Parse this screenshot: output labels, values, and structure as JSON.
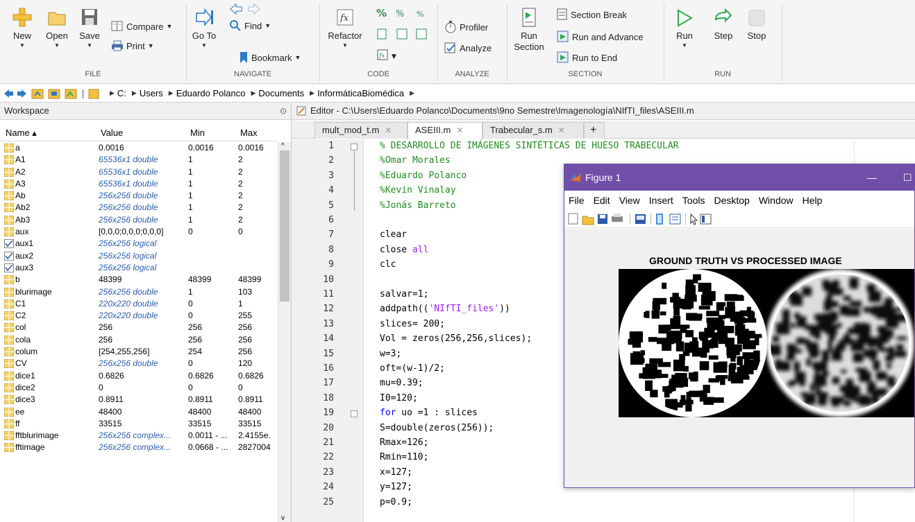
{
  "toolstrip": {
    "file": {
      "new": "New",
      "open": "Open",
      "save": "Save",
      "compare": "Compare",
      "print": "Print",
      "group": "FILE"
    },
    "navigate": {
      "goto": "Go To",
      "find": "Find",
      "bookmark": "Bookmark",
      "group": "NAVIGATE"
    },
    "code": {
      "refactor": "Refactor",
      "group": "CODE"
    },
    "analyze": {
      "profiler": "Profiler",
      "analyze": "Analyze",
      "group": "ANALYZE"
    },
    "section": {
      "run_section_1": "Run",
      "run_section_2": "Section",
      "section_break": "Section Break",
      "run_advance": "Run and Advance",
      "run_to_end": "Run to End",
      "group": "SECTION"
    },
    "run": {
      "run": "Run",
      "step": "Step",
      "stop": "Stop",
      "group": "RUN"
    }
  },
  "address": {
    "crumbs": [
      "C:",
      "Users",
      "Eduardo Polanco",
      "Documents",
      "InformáticaBiomédica"
    ]
  },
  "workspace": {
    "title": "Workspace",
    "columns": {
      "name": "Name ▴",
      "value": "Value",
      "min": "Min",
      "max": "Max"
    },
    "rows": [
      {
        "name": "a",
        "value": "0.0016",
        "min": "0.0016",
        "max": "0.0016",
        "type": "num"
      },
      {
        "name": "A1",
        "value": "65536x1 double",
        "min": "1",
        "max": "2",
        "type": "num",
        "italic": true
      },
      {
        "name": "A2",
        "value": "65536x1 double",
        "min": "1",
        "max": "2",
        "type": "num",
        "italic": true
      },
      {
        "name": "A3",
        "value": "65536x1 double",
        "min": "1",
        "max": "2",
        "type": "num",
        "italic": true
      },
      {
        "name": "Ab",
        "value": "256x256 double",
        "min": "1",
        "max": "2",
        "type": "num",
        "italic": true
      },
      {
        "name": "Ab2",
        "value": "256x256 double",
        "min": "1",
        "max": "2",
        "type": "num",
        "italic": true
      },
      {
        "name": "Ab3",
        "value": "256x256 double",
        "min": "1",
        "max": "2",
        "type": "num",
        "italic": true
      },
      {
        "name": "aux",
        "value": "[0,0,0;0,0,0;0,0,0]",
        "min": "0",
        "max": "0",
        "type": "num"
      },
      {
        "name": "aux1",
        "value": "256x256 logical",
        "min": "",
        "max": "",
        "type": "logical",
        "italic": true
      },
      {
        "name": "aux2",
        "value": "256x256 logical",
        "min": "",
        "max": "",
        "type": "logical",
        "italic": true
      },
      {
        "name": "aux3",
        "value": "256x256 logical",
        "min": "",
        "max": "",
        "type": "logical",
        "italic": true
      },
      {
        "name": "b",
        "value": "48399",
        "min": "48399",
        "max": "48399",
        "type": "num"
      },
      {
        "name": "blurimage",
        "value": "256x256 double",
        "min": "1",
        "max": "103",
        "type": "num",
        "italic": true
      },
      {
        "name": "C1",
        "value": "220x220 double",
        "min": "0",
        "max": "1",
        "type": "num",
        "italic": true
      },
      {
        "name": "C2",
        "value": "220x220 double",
        "min": "0",
        "max": "255",
        "type": "num",
        "italic": true
      },
      {
        "name": "col",
        "value": "256",
        "min": "256",
        "max": "256",
        "type": "num"
      },
      {
        "name": "cola",
        "value": "256",
        "min": "256",
        "max": "256",
        "type": "num"
      },
      {
        "name": "colum",
        "value": "[254,255,256]",
        "min": "254",
        "max": "256",
        "type": "num"
      },
      {
        "name": "CV",
        "value": "256x256 double",
        "min": "0",
        "max": "120",
        "type": "num",
        "italic": true
      },
      {
        "name": "dice1",
        "value": "0.6826",
        "min": "0.6826",
        "max": "0.6826",
        "type": "num"
      },
      {
        "name": "dice2",
        "value": "0",
        "min": "0",
        "max": "0",
        "type": "num"
      },
      {
        "name": "dice3",
        "value": "0.8911",
        "min": "0.8911",
        "max": "0.8911",
        "type": "num"
      },
      {
        "name": "ee",
        "value": "48400",
        "min": "48400",
        "max": "48400",
        "type": "num"
      },
      {
        "name": "ff",
        "value": "33515",
        "min": "33515",
        "max": "33515",
        "type": "num"
      },
      {
        "name": "fftblurimage",
        "value": "256x256 complex...",
        "min": "0.0011 - ...",
        "max": "2.4155e.",
        "type": "num",
        "italic": true
      },
      {
        "name": "fftimage",
        "value": "256x256 complex...",
        "min": "0.0668 - ...",
        "max": "2827004",
        "type": "num",
        "italic": true
      }
    ]
  },
  "editor": {
    "title": "Editor - C:\\Users\\Eduardo Polanco\\Documents\\9no Semestre\\Imagenología\\NIfTI_files\\ASEIII.m",
    "tabs": [
      "mult_mod_t.m",
      "ASEIII.m",
      "Trabecular_s.m"
    ],
    "add_tab": "+",
    "lines": [
      {
        "n": "1",
        "t": "% DESARROLLO DE IMÁGENES SINTÉTICAS DE HUESO TRABECULAR",
        "c": "cm"
      },
      {
        "n": "2",
        "t": "%Omar Morales",
        "c": "cm"
      },
      {
        "n": "3",
        "t": "%Eduardo Polanco",
        "c": "cm"
      },
      {
        "n": "4",
        "t": "%Kevin Vinalay",
        "c": "cm"
      },
      {
        "n": "5",
        "t": "%Jonás Barreto",
        "c": "cm"
      },
      {
        "n": "6",
        "t": "",
        "c": ""
      },
      {
        "n": "7",
        "t": "clear",
        "c": ""
      },
      {
        "n": "8",
        "t": "close ",
        "c": "",
        "extra": "all",
        "extra_c": "str"
      },
      {
        "n": "9",
        "t": "clc",
        "c": ""
      },
      {
        "n": "10",
        "t": "",
        "c": ""
      },
      {
        "n": "11",
        "t": "salvar=1;",
        "c": ""
      },
      {
        "n": "12",
        "t": "addpath((",
        "c": "",
        "extra": "'NIfTI_files'",
        "extra_c": "str",
        "after": "))"
      },
      {
        "n": "13",
        "t": "slices= 200;",
        "c": ""
      },
      {
        "n": "14",
        "t": "Vol = zeros(256,256,slices);",
        "c": ""
      },
      {
        "n": "15",
        "t": "w=3;",
        "c": ""
      },
      {
        "n": "16",
        "t": "oft=(w-1)/2;",
        "c": ""
      },
      {
        "n": "17",
        "t": "mu=0.39;",
        "c": ""
      },
      {
        "n": "18",
        "t": "I0=120;",
        "c": ""
      },
      {
        "n": "19",
        "t": "for",
        "c": "kw",
        "extra": " uo =1 : slices",
        "extra_c": ""
      },
      {
        "n": "20",
        "t": "S=double(zeros(256));",
        "c": ""
      },
      {
        "n": "21",
        "t": "Rmax=126;",
        "c": ""
      },
      {
        "n": "22",
        "t": "Rmin=110;",
        "c": ""
      },
      {
        "n": "23",
        "t": "x=127;",
        "c": ""
      },
      {
        "n": "24",
        "t": "y=127;",
        "c": ""
      },
      {
        "n": "25",
        "t": "p=0.9;",
        "c": ""
      }
    ]
  },
  "figure": {
    "title": "Figure 1",
    "menu": [
      "File",
      "Edit",
      "View",
      "Insert",
      "Tools",
      "Desktop",
      "Window",
      "Help"
    ],
    "plot_title": "GROUND TRUTH VS PROCESSED IMAGE"
  }
}
